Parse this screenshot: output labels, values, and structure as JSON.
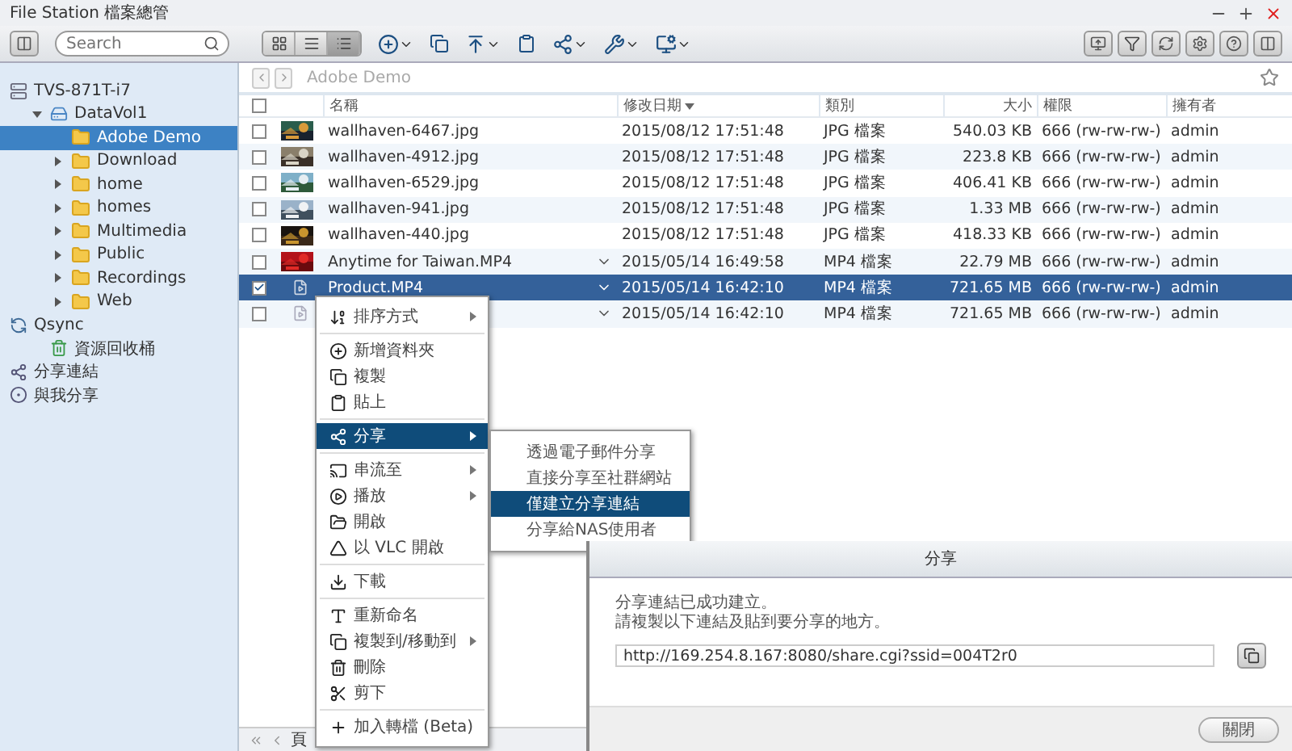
{
  "window": {
    "title": "File Station 檔案總管"
  },
  "search": {
    "placeholder": "Search"
  },
  "view_modes": [
    {
      "kind": "grid",
      "selected": false
    },
    {
      "kind": "list",
      "selected": false
    },
    {
      "kind": "details",
      "selected": true
    }
  ],
  "breadcrumb": "Adobe Demo",
  "sidebar": [
    {
      "label": "TVS-871T-i7",
      "kind": "nas",
      "selected": false,
      "children": [
        {
          "label": "DataVol1",
          "kind": "volume",
          "expanded": true,
          "selected": false,
          "children": [
            {
              "label": "Adobe Demo",
              "kind": "folder",
              "selected": true
            },
            {
              "label": "Download",
              "kind": "folder",
              "expanded": false,
              "selected": false
            },
            {
              "label": "home",
              "kind": "folder",
              "expanded": false,
              "selected": false
            },
            {
              "label": "homes",
              "kind": "folder",
              "expanded": false,
              "selected": false
            },
            {
              "label": "Multimedia",
              "kind": "folder",
              "expanded": false,
              "selected": false
            },
            {
              "label": "Public",
              "kind": "folder",
              "expanded": false,
              "selected": false
            },
            {
              "label": "Recordings",
              "kind": "folder",
              "expanded": false,
              "selected": false
            },
            {
              "label": "Web",
              "kind": "folder",
              "expanded": false,
              "selected": false
            }
          ]
        }
      ]
    },
    {
      "label": "Qsync",
      "kind": "sync",
      "selected": false,
      "children": [
        {
          "label": "資源回收桶",
          "kind": "trash",
          "selected": false
        }
      ]
    },
    {
      "label": "分享連結",
      "kind": "share",
      "selected": false
    },
    {
      "label": "與我分享",
      "kind": "shared",
      "selected": false
    }
  ],
  "select_all": {
    "checked": false
  },
  "columns": [
    {
      "label": "名稱",
      "sorted": false
    },
    {
      "label": "修改日期",
      "sorted": true
    },
    {
      "label": "類別",
      "sorted": false
    },
    {
      "label": "大小",
      "sorted": false
    },
    {
      "label": "權限",
      "sorted": false
    },
    {
      "label": "擁有者",
      "sorted": false
    }
  ],
  "rows": [
    {
      "name": "wallhaven-6467.jpg",
      "date": "2015/08/12 17:51:48",
      "type": "JPG 檔案",
      "size": "540.03 KB",
      "permission": "666 (rw-rw-rw-)",
      "owner": "admin",
      "kind": "picture",
      "has_menu": false,
      "checked": false,
      "selected": false
    },
    {
      "name": "wallhaven-4912.jpg",
      "date": "2015/08/12 17:51:48",
      "type": "JPG 檔案",
      "size": "223.8 KB",
      "permission": "666 (rw-rw-rw-)",
      "owner": "admin",
      "kind": "picture",
      "has_menu": false,
      "checked": false,
      "selected": false
    },
    {
      "name": "wallhaven-6529.jpg",
      "date": "2015/08/12 17:51:48",
      "type": "JPG 檔案",
      "size": "406.41 KB",
      "permission": "666 (rw-rw-rw-)",
      "owner": "admin",
      "kind": "picture",
      "has_menu": false,
      "checked": false,
      "selected": false
    },
    {
      "name": "wallhaven-941.jpg",
      "date": "2015/08/12 17:51:48",
      "type": "JPG 檔案",
      "size": "1.33 MB",
      "permission": "666 (rw-rw-rw-)",
      "owner": "admin",
      "kind": "picture",
      "has_menu": false,
      "checked": false,
      "selected": false
    },
    {
      "name": "wallhaven-440.jpg",
      "date": "2015/08/12 17:51:48",
      "type": "JPG 檔案",
      "size": "418.33 KB",
      "permission": "666 (rw-rw-rw-)",
      "owner": "admin",
      "kind": "picture",
      "has_menu": false,
      "checked": false,
      "selected": false
    },
    {
      "name": "Anytime for Taiwan.MP4",
      "date": "2015/05/14 16:49:58",
      "type": "MP4 檔案",
      "size": "22.79 MB",
      "permission": "666 (rw-rw-rw-)",
      "owner": "admin",
      "kind": "picture",
      "has_menu": true,
      "checked": false,
      "selected": false
    },
    {
      "name": "Product.MP4",
      "date": "2015/05/14 16:42:10",
      "type": "MP4 檔案",
      "size": "721.65 MB",
      "permission": "666 (rw-rw-rw-)",
      "owner": "admin",
      "kind": "file",
      "has_menu": true,
      "checked": true,
      "selected": true
    },
    {
      "date": "2015/05/14 16:42:10",
      "type": "MP4 檔案",
      "size": "721.65 MB",
      "permission": "666 (rw-rw-rw-)",
      "owner": "admin",
      "kind": "file",
      "has_menu": true,
      "checked": false,
      "selected": false
    }
  ],
  "pager": {
    "label": "頁"
  },
  "context_menu": [
    {
      "kind": "item",
      "label": "排序方式",
      "submenu": true,
      "selected": false
    },
    {
      "kind": "separator"
    },
    {
      "kind": "item",
      "label": "新增資料夾",
      "submenu": false,
      "selected": false
    },
    {
      "kind": "item",
      "label": "複製",
      "submenu": false,
      "selected": false
    },
    {
      "kind": "item",
      "label": "貼上",
      "submenu": false,
      "selected": false
    },
    {
      "kind": "separator"
    },
    {
      "kind": "item",
      "label": "分享",
      "submenu": true,
      "selected": true
    },
    {
      "kind": "separator"
    },
    {
      "kind": "item",
      "label": "串流至",
      "submenu": true,
      "selected": false
    },
    {
      "kind": "item",
      "label": "播放",
      "submenu": true,
      "selected": false
    },
    {
      "kind": "item",
      "label": "開啟",
      "submenu": false,
      "selected": false
    },
    {
      "kind": "item",
      "label": "以 VLC 開啟",
      "submenu": false,
      "selected": false
    },
    {
      "kind": "separator"
    },
    {
      "kind": "item",
      "label": "下載",
      "submenu": false,
      "selected": false
    },
    {
      "kind": "separator"
    },
    {
      "kind": "item",
      "label": "重新命名",
      "submenu": false,
      "selected": false
    },
    {
      "kind": "item",
      "label": "複製到/移動到",
      "submenu": true,
      "selected": false
    },
    {
      "kind": "item",
      "label": "刪除",
      "submenu": false,
      "selected": false
    },
    {
      "kind": "item",
      "label": "剪下",
      "submenu": false,
      "selected": false
    },
    {
      "kind": "separator"
    },
    {
      "kind": "item",
      "label": "加入轉檔 (Beta)",
      "submenu": false,
      "selected": false
    }
  ],
  "share_submenu": [
    {
      "label": "透過電子郵件分享",
      "selected": false
    },
    {
      "label": "直接分享至社群網站",
      "selected": false
    },
    {
      "label": "僅建立分享連結",
      "selected": true
    },
    {
      "label": "分享給NAS使用者",
      "selected": false
    }
  ],
  "dialog": {
    "title": "分享",
    "message": [
      "分享連結已成功建立。",
      "請複製以下連結及貼到要分享的地方。"
    ],
    "link": "http://169.254.8.167:8080/share.cgi?ssid=004T2r0",
    "button": "關閉"
  }
}
